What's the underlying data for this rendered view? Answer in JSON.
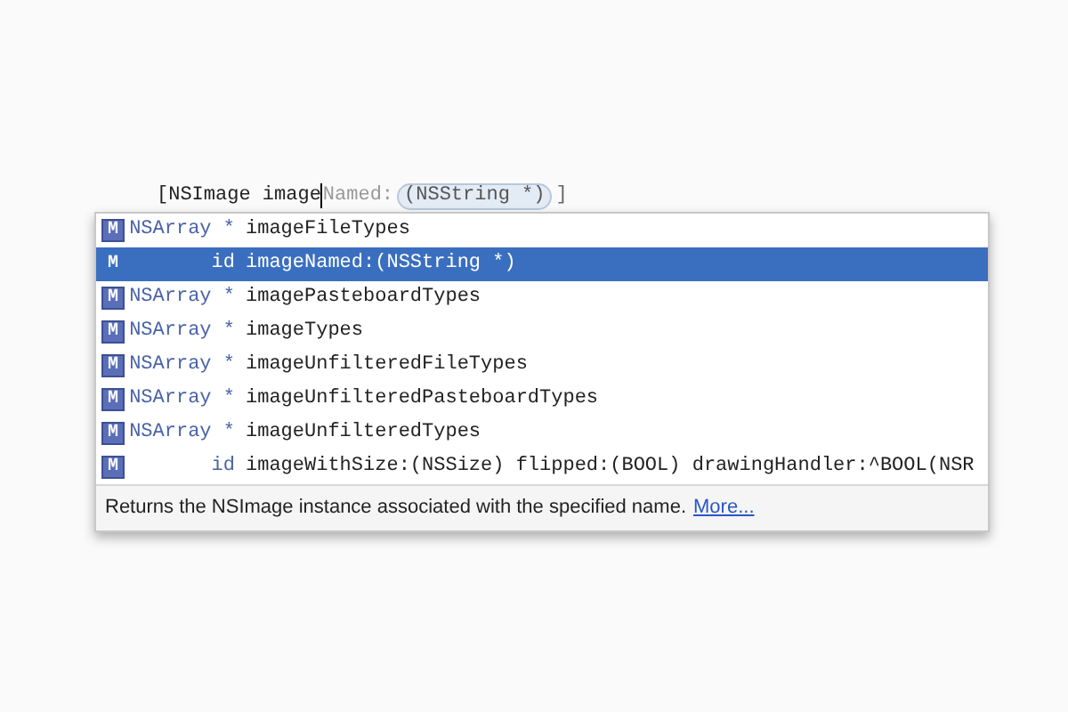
{
  "editor": {
    "typed": "[NSImage image",
    "completion_hint": "Named:",
    "placeholder_token": "(NSString *)",
    "closing": "]"
  },
  "completions": [
    {
      "badge": "M",
      "type": "NSArray *",
      "name": "imageFileTypes",
      "selected": false
    },
    {
      "badge": "M",
      "type": "id",
      "name": "imageNamed:(NSString *)",
      "selected": true
    },
    {
      "badge": "M",
      "type": "NSArray *",
      "name": "imagePasteboardTypes",
      "selected": false
    },
    {
      "badge": "M",
      "type": "NSArray *",
      "name": "imageTypes",
      "selected": false
    },
    {
      "badge": "M",
      "type": "NSArray *",
      "name": "imageUnfilteredFileTypes",
      "selected": false
    },
    {
      "badge": "M",
      "type": "NSArray *",
      "name": "imageUnfilteredPasteboardTypes",
      "selected": false
    },
    {
      "badge": "M",
      "type": "NSArray *",
      "name": "imageUnfilteredTypes",
      "selected": false
    },
    {
      "badge": "M",
      "type": "id",
      "name": "imageWithSize:(NSSize) flipped:(BOOL) drawingHandler:^BOOL(NSR",
      "selected": false
    }
  ],
  "description": {
    "text": "Returns the NSImage instance associated with the specified name.",
    "link": "More..."
  }
}
